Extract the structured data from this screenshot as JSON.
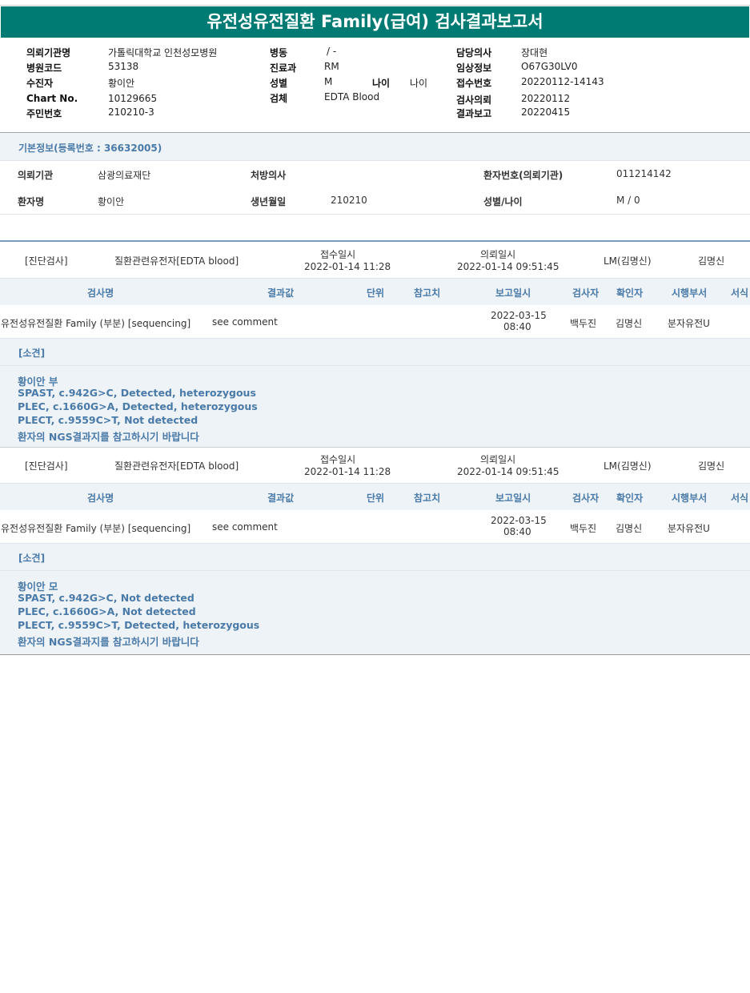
{
  "title": "유전성유전질환 Family(급여) 검사결과보고서",
  "header": {
    "institution_label": "의뢰기관명",
    "institution": "가톨릭대학교 인천성모병원",
    "hospital_code_label": "병원코드",
    "hospital_code": "53138",
    "recipient_label": "수진자",
    "recipient": "황이안",
    "chart_no_label": "Chart No.",
    "chart_no": "10129665",
    "resident_no_label": "주민번호",
    "resident_no": "210210-3",
    "ward_label": "병동",
    "ward": "/ -",
    "dept_label": "진료과",
    "dept": "RM",
    "sex_label": "성별",
    "sex": "M",
    "age_label": "나이",
    "age": "나이",
    "specimen_label": "검체",
    "specimen": "EDTA Blood",
    "doctor_label": "담당의사",
    "doctor": "장대현",
    "clinical_label": "임상정보",
    "clinical": "O67G30LV0",
    "receipt_no_label": "접수번호",
    "receipt_no": "20220112-14143",
    "request_label": "검사의뢰",
    "request": "20220112",
    "report_label": "결과보고",
    "report": "20220415"
  },
  "basic": {
    "title": "기본정보(등록번호 : 36632005)",
    "req_inst_label": "의뢰기관",
    "req_inst": "삼광의료재단",
    "prescriber_label": "처방의사",
    "prescriber": "",
    "patient_no_label": "환자번호(의뢰기관)",
    "patient_no": "011214142",
    "name_label": "환자명",
    "name": "황이안",
    "birth_label": "생년월일",
    "birth": "210210",
    "sex_age_label": "성별/나이",
    "sex_age": "M / 0"
  },
  "columns": [
    "검사명",
    "결과값",
    "단위",
    "참고치",
    "보고일시",
    "검사자",
    "확인자",
    "시행부서",
    "서식"
  ],
  "sections": [
    {
      "category": "[진단검사]",
      "test_group": "질환관련유전자[EDTA blood]",
      "receipt_label": "접수일시",
      "receipt_time": "2022-01-14 11:28",
      "request_label": "의뢰일시",
      "request_time": "2022-01-14 09:51:45",
      "lm": "LM(김명신)",
      "signer": "김명신",
      "row": {
        "test_name": "유전성유전질환 Family (부분) [sequencing]",
        "result": "see comment",
        "report_date": "2022-03-15",
        "report_time": "08:40",
        "tester": "백두진",
        "confirmer": "김명신",
        "dept": "분자유전U"
      },
      "comment_label": "[소견]",
      "comments": [
        "황이안 부",
        "SPAST, c.942G>C, Detected, heterozygous",
        "PLEC, c.1660G>A, Detected, heterozygous",
        "PLECT, c.9559C>T, Not detected",
        "환자의 NGS결과지를 참고하시기 바랍니다"
      ]
    },
    {
      "category": "[진단검사]",
      "test_group": "질환관련유전자[EDTA blood]",
      "receipt_label": "접수일시",
      "receipt_time": "2022-01-14 11:28",
      "request_label": "의뢰일시",
      "request_time": "2022-01-14 09:51:45",
      "lm": "LM(김명신)",
      "signer": "김명신",
      "row": {
        "test_name": "유전성유전질환 Family (부분) [sequencing]",
        "result": "see comment",
        "report_date": "2022-03-15",
        "report_time": "08:40",
        "tester": "백두진",
        "confirmer": "김명신",
        "dept": "분자유전U"
      },
      "comment_label": "[소견]",
      "comments": [
        "황이안 모",
        "SPAST, c.942G>C, Not detected",
        "PLEC, c.1660G>A, Not detected",
        "PLECT, c.9559C>T, Detected, heterozygous",
        "환자의 NGS결과지를 참고하시기 바랍니다"
      ]
    }
  ]
}
